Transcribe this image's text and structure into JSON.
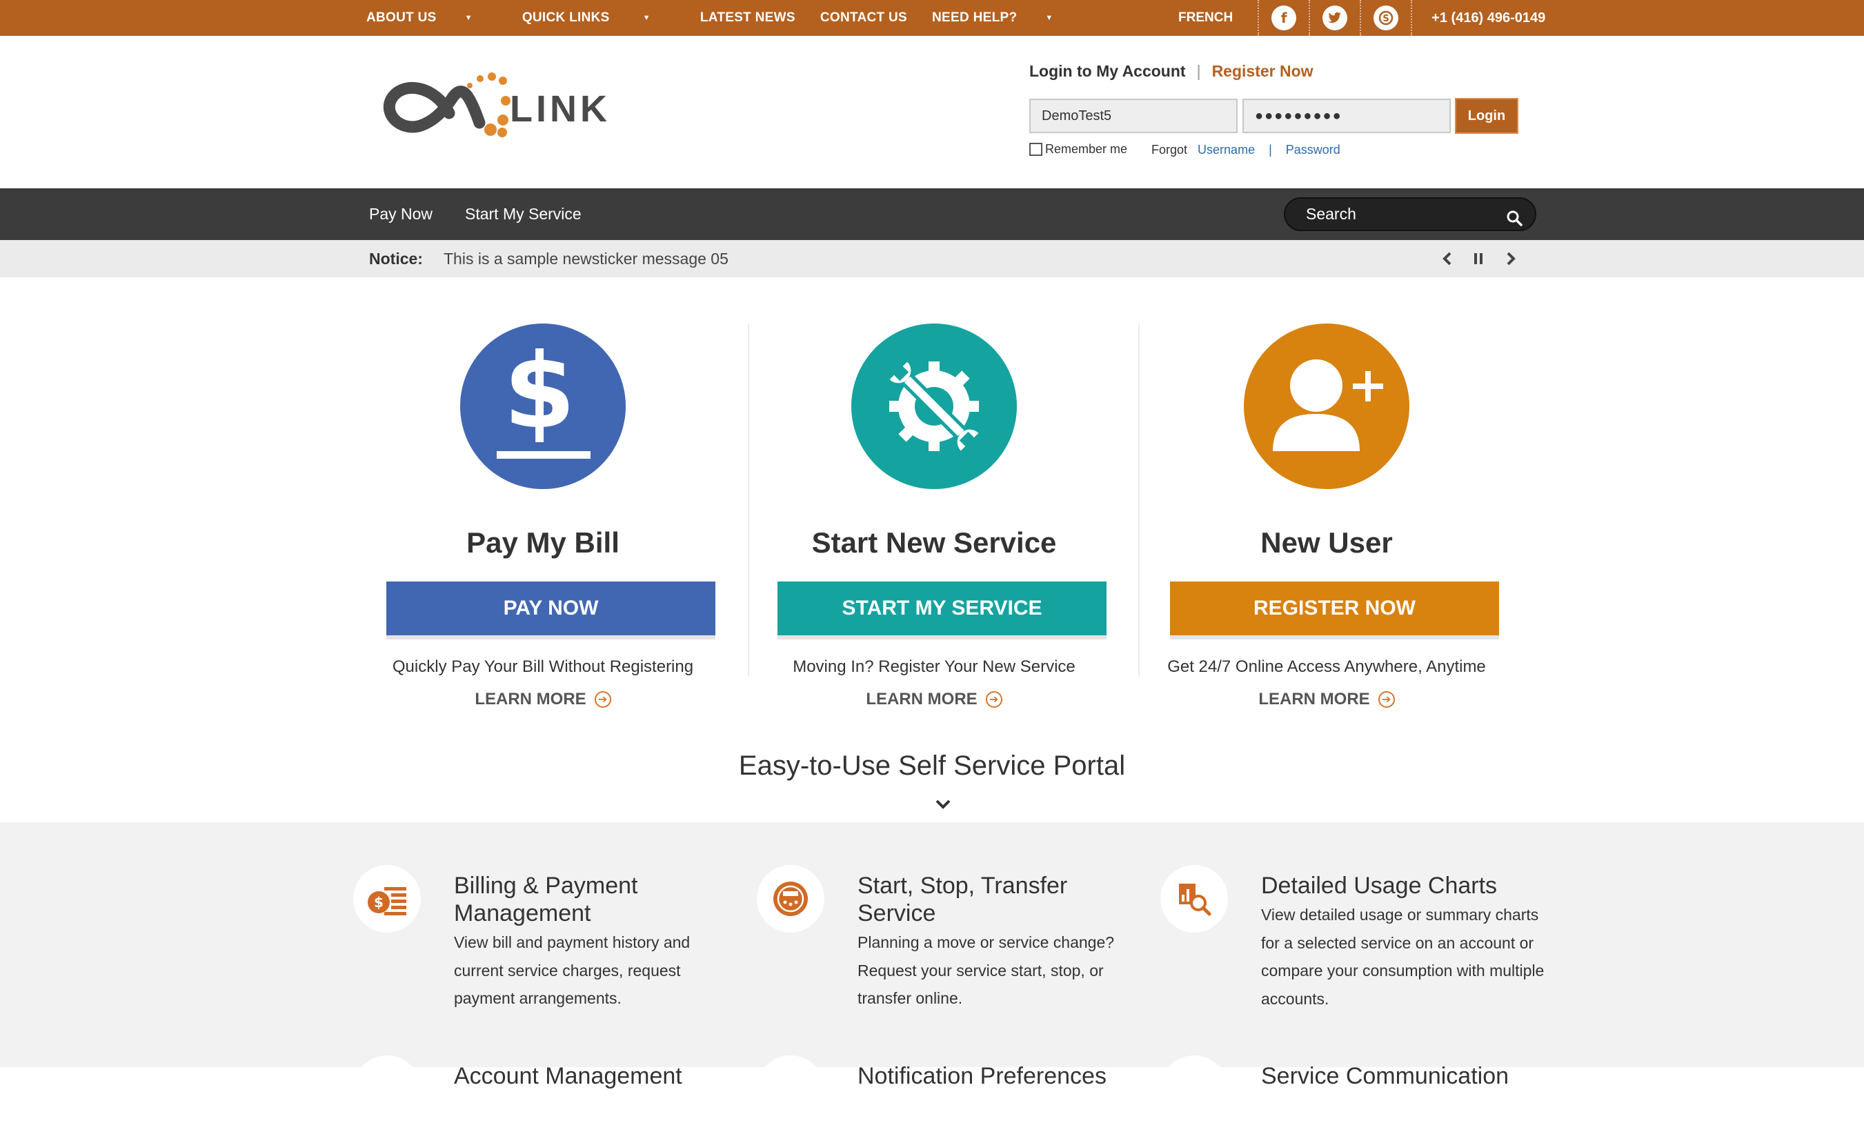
{
  "topbar": {
    "nav": [
      {
        "label": "ABOUT US",
        "dropdown": true
      },
      {
        "label": "QUICK LINKS",
        "dropdown": true
      },
      {
        "label": "LATEST NEWS",
        "dropdown": false
      },
      {
        "label": "CONTACT US",
        "dropdown": false
      },
      {
        "label": "NEED HELP?",
        "dropdown": true
      }
    ],
    "language": "FRENCH",
    "social": [
      "facebook-icon",
      "twitter-icon",
      "skype-icon"
    ],
    "phone": "+1 (416) 496-0149"
  },
  "logo": {
    "text": "LINK"
  },
  "login": {
    "title": "Login to My Account",
    "separator": "|",
    "register": "Register Now",
    "username_value": "DemoTest5",
    "password_value": "●●●●●●●●●",
    "button": "Login",
    "remember": "Remember me",
    "forgot": "Forgot",
    "forgot_username": "Username",
    "forgot_sep": "|",
    "forgot_password": "Password"
  },
  "mainnav": {
    "items": [
      "Pay Now",
      "Start My Service"
    ],
    "search_placeholder": "Search"
  },
  "ticker": {
    "label": "Notice:",
    "message": "This is a sample newsticker message 05"
  },
  "features": [
    {
      "title": "Pay My Bill",
      "button": "PAY NOW",
      "desc": "Quickly Pay Your Bill Without Registering",
      "more": "LEARN MORE",
      "color": "#4267b2",
      "icon": "dollar-icon"
    },
    {
      "title": "Start New Service",
      "button": "START MY SERVICE",
      "desc": "Moving In? Register Your New Service",
      "more": "LEARN MORE",
      "color": "#15a3a0",
      "icon": "gear-wrench-icon"
    },
    {
      "title": "New User",
      "button": "REGISTER NOW",
      "desc": "Get 24/7 Online Access Anywhere, Anytime",
      "more": "LEARN MORE",
      "color": "#d8820f",
      "icon": "add-user-icon"
    }
  ],
  "portal": {
    "heading": "Easy-to-Use Self Service Portal"
  },
  "services": [
    {
      "title": "Billing & Payment Management",
      "desc": "View bill and payment history and current service charges, request payment arrangements.",
      "icon": "billing-icon"
    },
    {
      "title": "Start, Stop, Transfer Service",
      "desc": "Planning a move or service change? Request your service start, stop, or transfer online.",
      "icon": "meter-icon"
    },
    {
      "title": "Detailed Usage Charts",
      "desc": "View detailed usage or summary charts for a selected service on an account or compare your consumption with multiple accounts.",
      "icon": "usage-chart-icon"
    },
    {
      "title": "Account Management",
      "icon": "account-icon"
    },
    {
      "title": "Notification Preferences",
      "icon": "notification-icon"
    },
    {
      "title": "Service Communication",
      "icon": "communication-icon"
    }
  ],
  "colors": {
    "accent": "#b4601f",
    "dark_nav": "#3c3c3c"
  }
}
